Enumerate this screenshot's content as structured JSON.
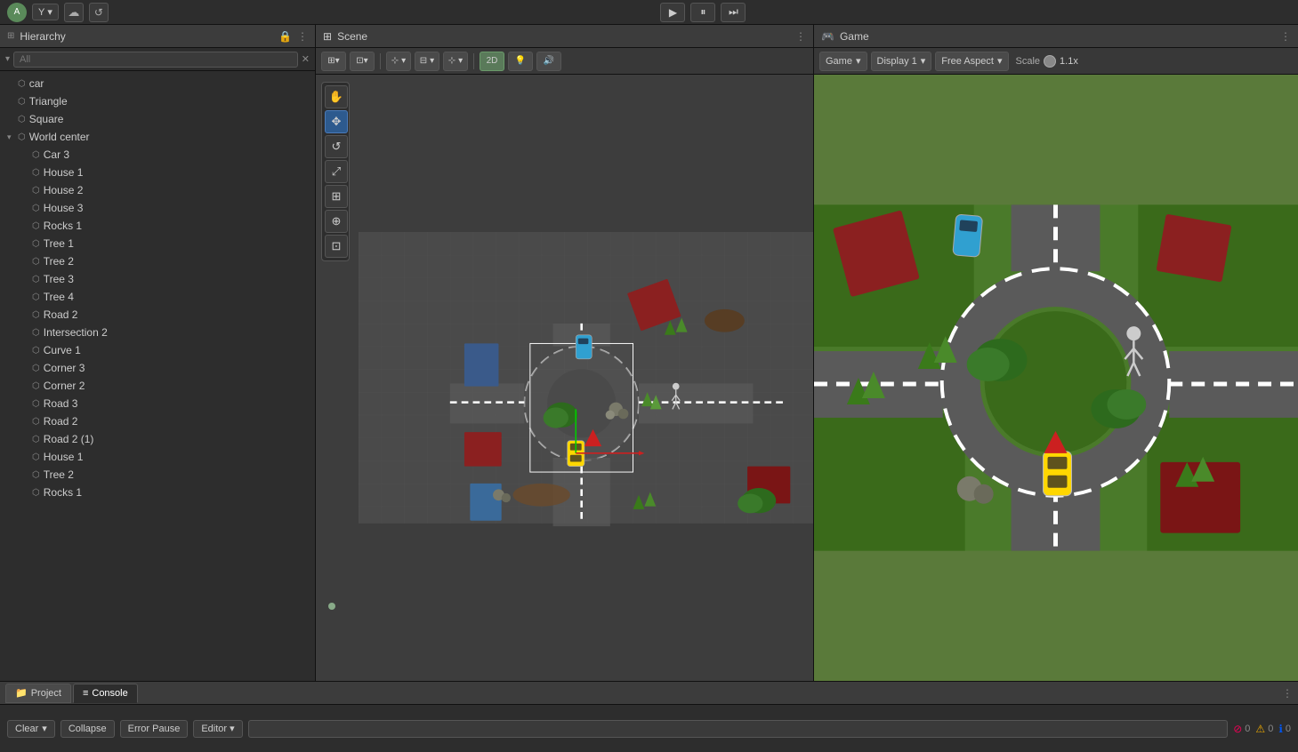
{
  "topbar": {
    "account_label": "A",
    "account_dropdown": "Y ▾",
    "play_label": "▶",
    "pause_label": "⏸",
    "step_label": "⏭"
  },
  "hierarchy": {
    "title": "Hierarchy",
    "search_placeholder": "All",
    "items": [
      {
        "id": "car",
        "label": "car",
        "depth": 0,
        "expanded": false
      },
      {
        "id": "triangle",
        "label": "Triangle",
        "depth": 0,
        "expanded": false
      },
      {
        "id": "square",
        "label": "Square",
        "depth": 0,
        "expanded": false
      },
      {
        "id": "world-center",
        "label": "World center",
        "depth": 0,
        "expanded": true
      },
      {
        "id": "car3",
        "label": "Car 3",
        "depth": 1,
        "expanded": false
      },
      {
        "id": "house1a",
        "label": "House 1",
        "depth": 1,
        "expanded": false
      },
      {
        "id": "house2",
        "label": "House 2",
        "depth": 1,
        "expanded": false
      },
      {
        "id": "house3",
        "label": "House 3",
        "depth": 1,
        "expanded": false
      },
      {
        "id": "rocks1",
        "label": "Rocks 1",
        "depth": 1,
        "expanded": false
      },
      {
        "id": "tree1",
        "label": "Tree 1",
        "depth": 1,
        "expanded": false
      },
      {
        "id": "tree2",
        "label": "Tree 2",
        "depth": 1,
        "expanded": false
      },
      {
        "id": "tree3",
        "label": "Tree 3",
        "depth": 1,
        "expanded": false
      },
      {
        "id": "tree4",
        "label": "Tree 4",
        "depth": 1,
        "expanded": false
      },
      {
        "id": "road2a",
        "label": "Road 2",
        "depth": 1,
        "expanded": false
      },
      {
        "id": "intersection2",
        "label": "Intersection 2",
        "depth": 1,
        "expanded": false
      },
      {
        "id": "curve1",
        "label": "Curve 1",
        "depth": 1,
        "expanded": false
      },
      {
        "id": "corner3",
        "label": "Corner 3",
        "depth": 1,
        "expanded": false
      },
      {
        "id": "corner2",
        "label": "Corner 2",
        "depth": 1,
        "expanded": false
      },
      {
        "id": "road3",
        "label": "Road 3",
        "depth": 1,
        "expanded": false
      },
      {
        "id": "road2b",
        "label": "Road 2",
        "depth": 1,
        "expanded": false
      },
      {
        "id": "road2_1",
        "label": "Road 2 (1)",
        "depth": 1,
        "expanded": false
      },
      {
        "id": "house1b",
        "label": "House 1",
        "depth": 1,
        "expanded": false
      },
      {
        "id": "tree2b",
        "label": "Tree 2",
        "depth": 1,
        "expanded": false
      },
      {
        "id": "rocks1b",
        "label": "Rocks 1",
        "depth": 1,
        "expanded": false
      }
    ]
  },
  "scene": {
    "title": "Scene",
    "toolbar": {
      "move_label": "✋",
      "transform_label": "✥",
      "rotate_label": "↺",
      "scale_label": "⤢",
      "rect_label": "⊞",
      "custom_label": "⊕",
      "pivot_label": "⊡",
      "grid_label": "⊞",
      "snap_label": "⊹",
      "view_label": "◉",
      "mode_2d": "2D",
      "light_label": "💡"
    }
  },
  "game": {
    "title": "Game",
    "tab_label": "Game",
    "display_label": "Display 1",
    "aspect_label": "Free Aspect",
    "scale_label": "Scale",
    "scale_value": "1.1x"
  },
  "console": {
    "tab_project": "Project",
    "tab_console": "Console",
    "clear_label": "Clear",
    "collapse_label": "Collapse",
    "error_pause_label": "Error Pause",
    "editor_label": "Editor ▾",
    "search_placeholder": "",
    "error_count": "0",
    "warn_count": "0",
    "info_count": "0"
  }
}
